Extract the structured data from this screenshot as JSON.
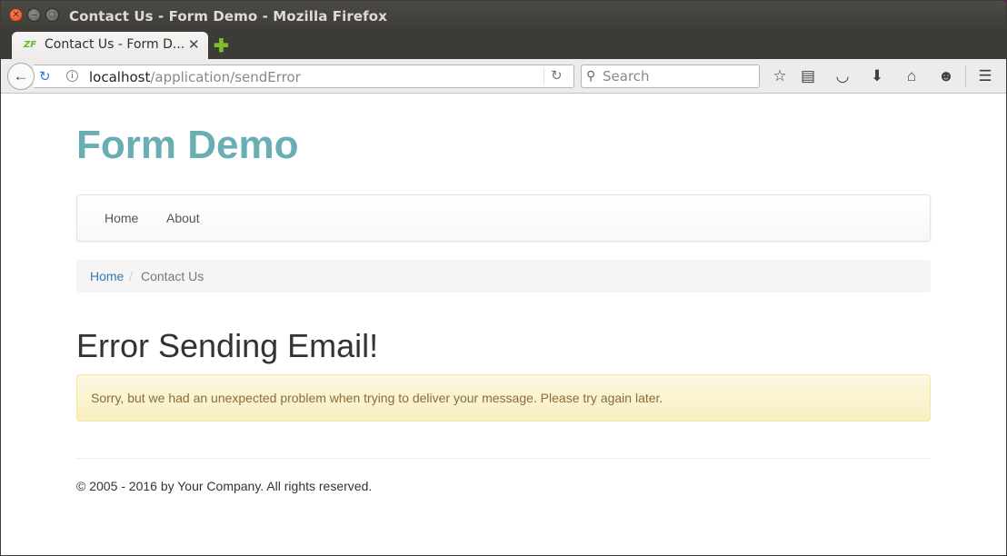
{
  "window": {
    "title": "Contact Us - Form Demo - Mozilla Firefox"
  },
  "tabs": [
    {
      "label": "Contact Us - Form D...",
      "favicon": "ZF"
    }
  ],
  "toolbar": {
    "url_host": "localhost",
    "url_path": "/application/sendError",
    "search_placeholder": "Search"
  },
  "site": {
    "title": "Form Demo",
    "nav": [
      {
        "label": "Home"
      },
      {
        "label": "About"
      }
    ],
    "breadcrumb": {
      "home": "Home",
      "separator": "/",
      "current": "Contact Us"
    },
    "heading": "Error Sending Email!",
    "alert": "Sorry, but we had an unexpected problem when trying to deliver your message. Please try again later.",
    "footer": "© 2005 - 2016 by Your Company. All rights reserved."
  },
  "colors": {
    "title": "#68aeb2",
    "link": "#337ab7",
    "alert_text": "#8a6d3b",
    "alert_bg": "#fcf8e3"
  }
}
